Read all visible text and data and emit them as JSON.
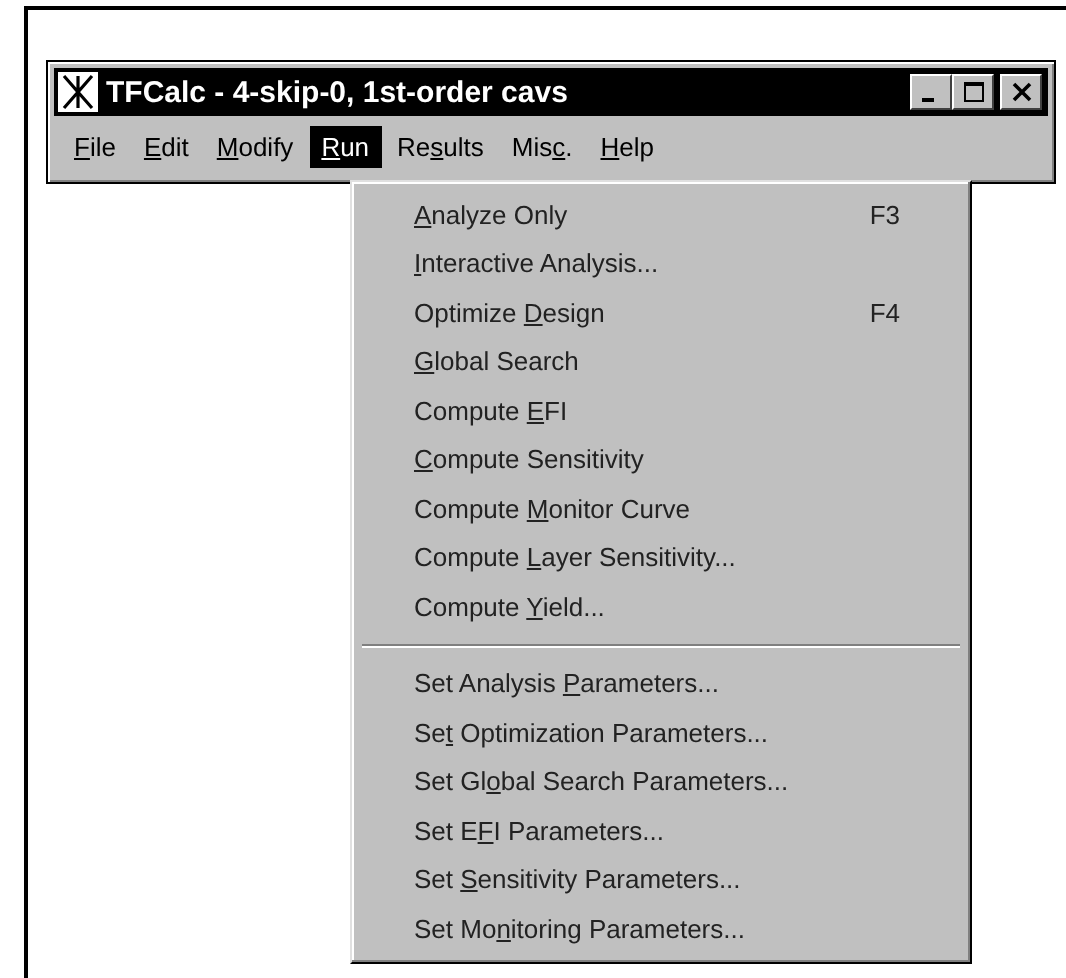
{
  "window": {
    "title": "TFCalc - 4-skip-0, 1st-order cavs"
  },
  "menu_bar": [
    {
      "text": {
        "key": "F",
        "after": "ile"
      },
      "selected": false
    },
    {
      "text": {
        "key": "E",
        "after": "dit"
      },
      "selected": false
    },
    {
      "text": {
        "key": "M",
        "after": "odify"
      },
      "selected": false
    },
    {
      "text": {
        "key": "R",
        "after": "un"
      },
      "selected": true
    },
    {
      "text": {
        "before": "Re",
        "key": "s",
        "after": "ults"
      },
      "selected": false
    },
    {
      "text": {
        "before": "Mis",
        "key": "c",
        "after": "."
      },
      "selected": false
    },
    {
      "text": {
        "key": "H",
        "after": "elp"
      },
      "selected": false
    }
  ],
  "run_menu": [
    {
      "kind": "command",
      "text": {
        "key": "A",
        "after": "nalyze Only"
      },
      "shortcut": "F3"
    },
    {
      "kind": "command",
      "text": {
        "key": "I",
        "after": "nteractive Analysis..."
      }
    },
    {
      "kind": "command",
      "text": {
        "before": "Optimize ",
        "key": "D",
        "after": "esign"
      },
      "shortcut": "F4"
    },
    {
      "kind": "command",
      "text": {
        "key": "G",
        "after": "lobal Search"
      }
    },
    {
      "kind": "command",
      "text": {
        "before": "Compute ",
        "key": "E",
        "after": "FI"
      }
    },
    {
      "kind": "command",
      "text": {
        "key": "C",
        "after": "ompute Sensitivity"
      }
    },
    {
      "kind": "command",
      "text": {
        "before": "Compute ",
        "key": "M",
        "after": "onitor Curve"
      }
    },
    {
      "kind": "command",
      "text": {
        "before": "Compute ",
        "key": "L",
        "after": "ayer Sensitivity..."
      }
    },
    {
      "kind": "command",
      "text": {
        "before": "Compute ",
        "key": "Y",
        "after": "ield..."
      }
    },
    {
      "kind": "separator"
    },
    {
      "kind": "command",
      "text": {
        "before": "Set Analysis ",
        "key": "P",
        "after": "arameters..."
      }
    },
    {
      "kind": "command",
      "text": {
        "before": "Se",
        "key": "t",
        "after": " Optimization Parameters..."
      }
    },
    {
      "kind": "command",
      "text": {
        "before": "Set Gl",
        "key": "o",
        "after": "bal Search Parameters..."
      }
    },
    {
      "kind": "command",
      "text": {
        "before": "Set E",
        "key": "F",
        "after": "I Parameters..."
      }
    },
    {
      "kind": "command",
      "text": {
        "before": "Set ",
        "key": "S",
        "after": "ensitivity Parameters..."
      }
    },
    {
      "kind": "command",
      "text": {
        "before": "Set Mo",
        "key": "n",
        "after": "itoring Parameters..."
      }
    }
  ]
}
